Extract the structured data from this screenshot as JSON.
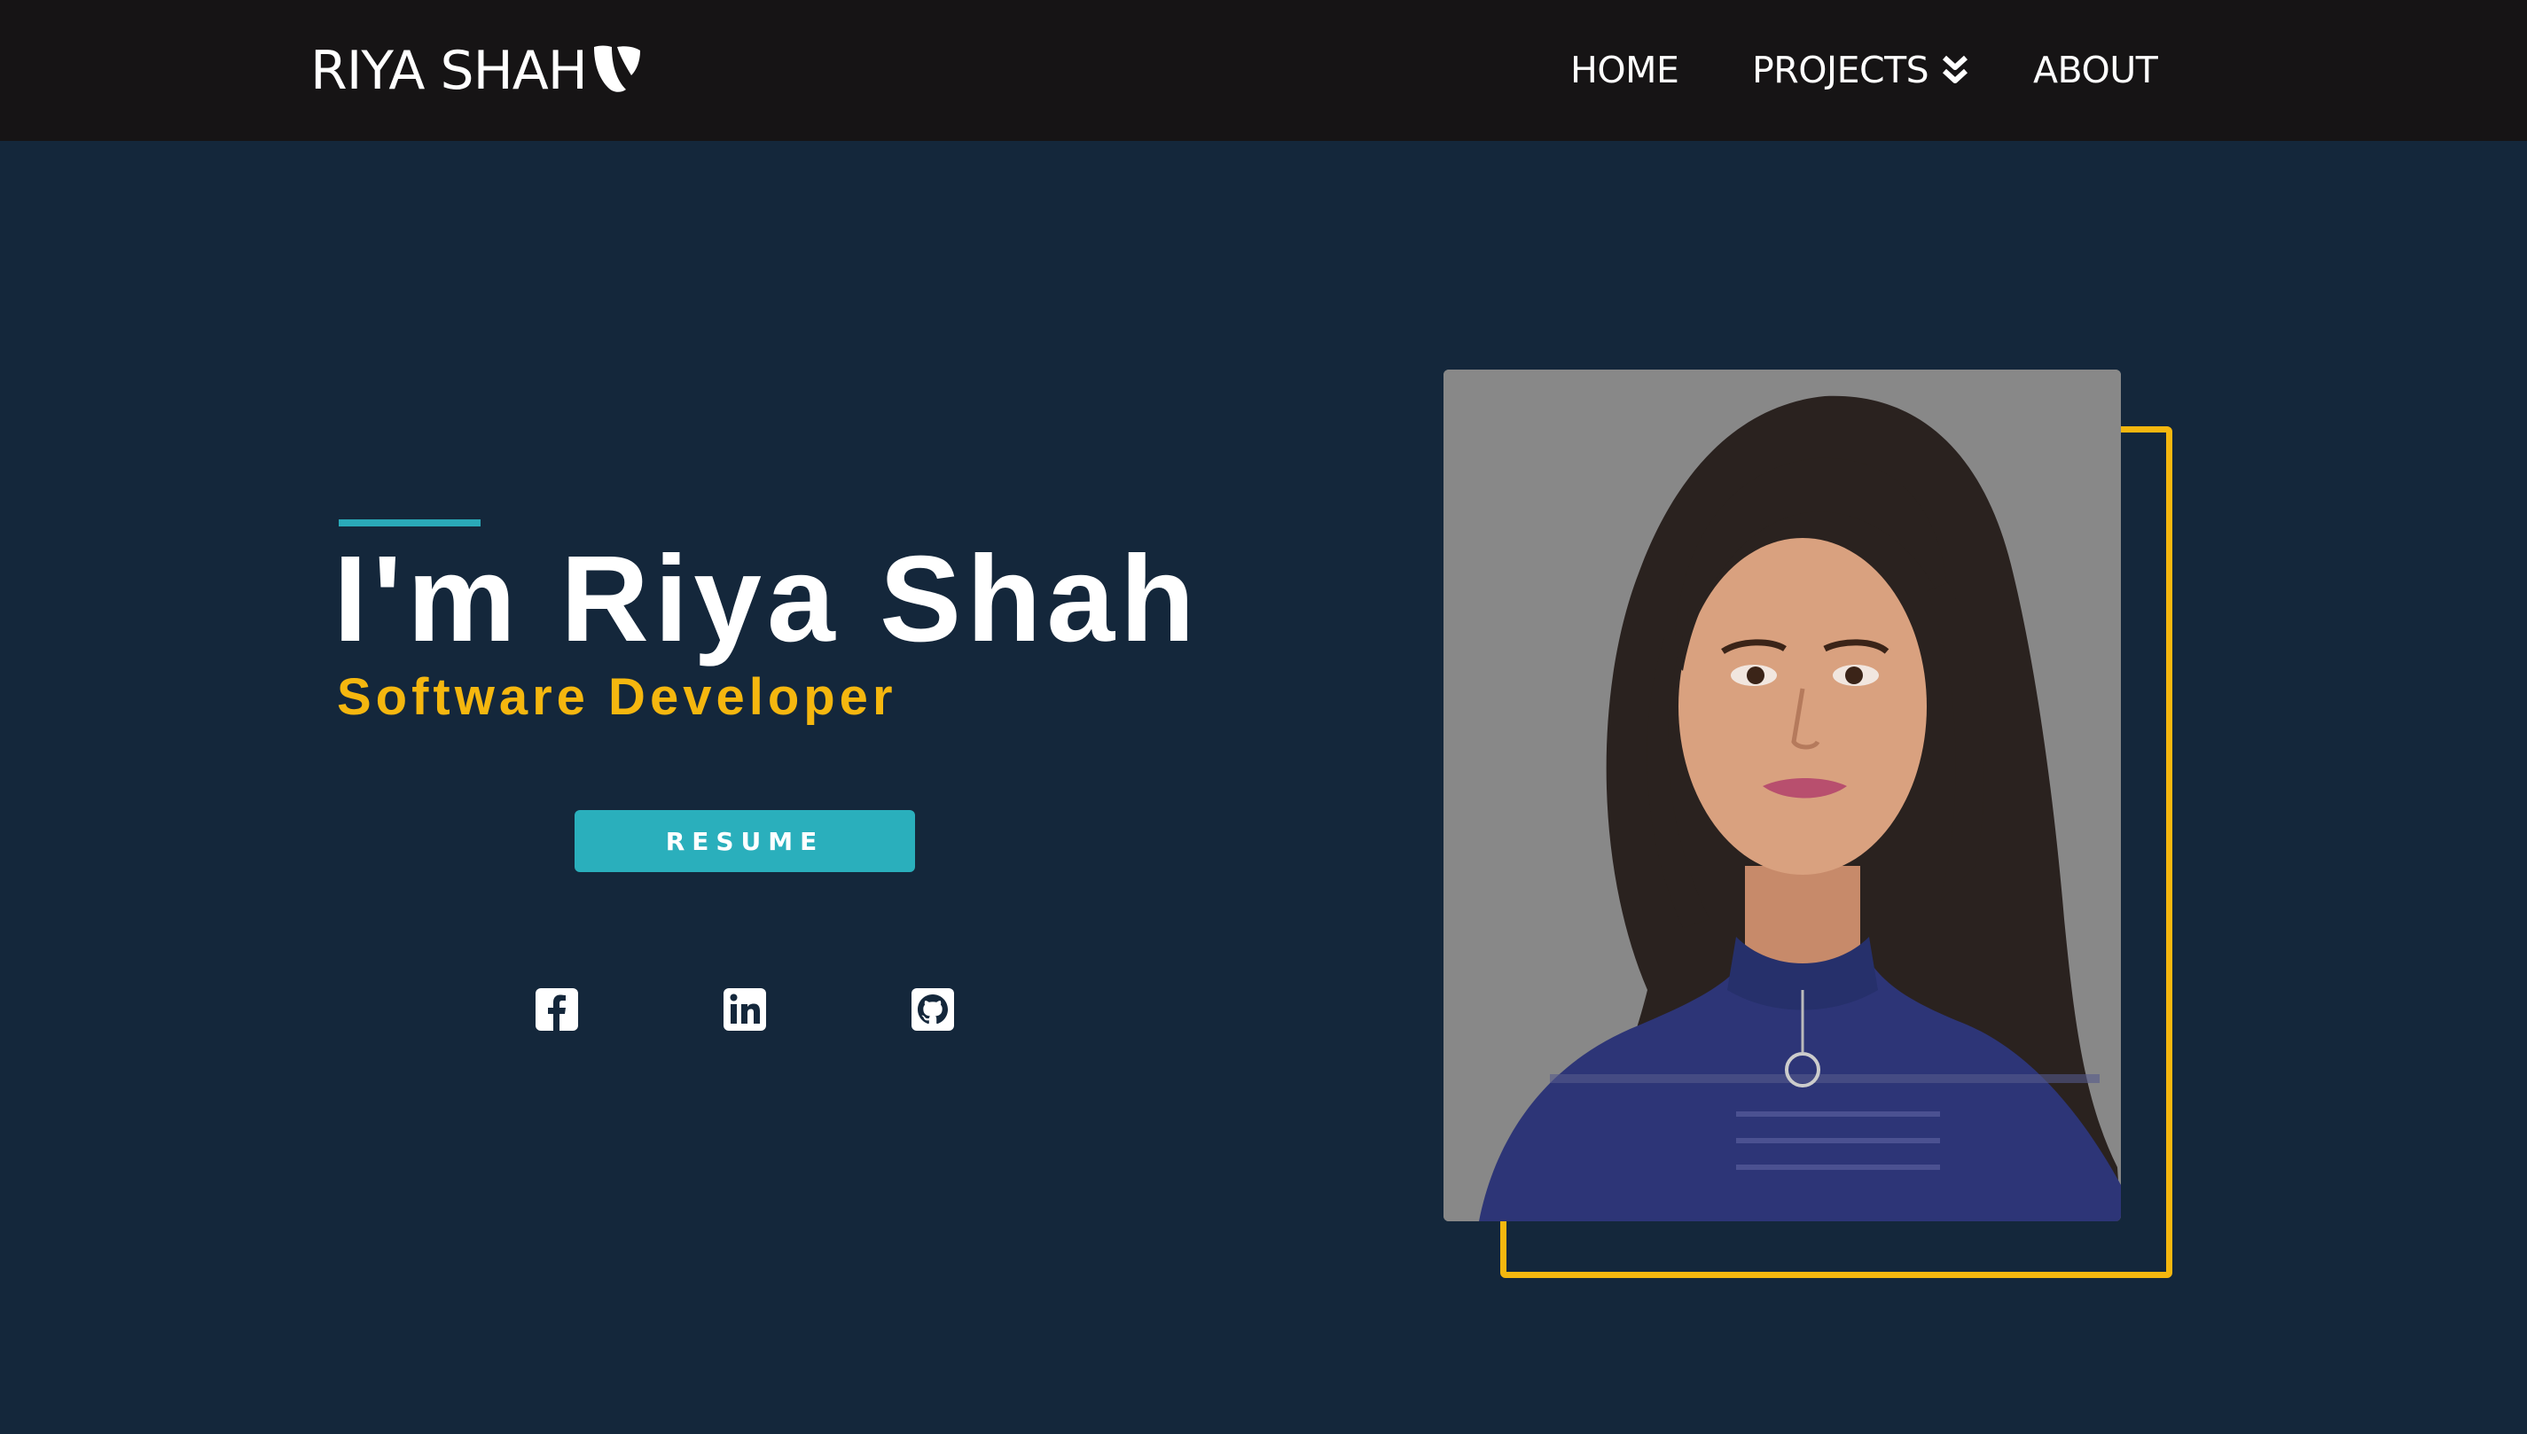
{
  "header": {
    "brand": "RIYA SHAH",
    "brand_logo": "typo3-logo",
    "nav": {
      "home": "HOME",
      "projects": "PROJECTS",
      "projects_icon": "double-chevron-down-icon",
      "about": "ABOUT"
    }
  },
  "hero": {
    "title": "I'm Riya Shah",
    "subtitle": "Software Developer",
    "resume_label": "RESUME",
    "social": [
      {
        "icon": "facebook-icon"
      },
      {
        "icon": "linkedin-icon"
      },
      {
        "icon": "github-icon"
      }
    ],
    "photo_icon": "profile-photo"
  },
  "colors": {
    "navbar": "#161415",
    "background": "#14273b",
    "accent_teal": "#2aafbc",
    "accent_yellow": "#f5b70f",
    "text": "#ffffff"
  }
}
